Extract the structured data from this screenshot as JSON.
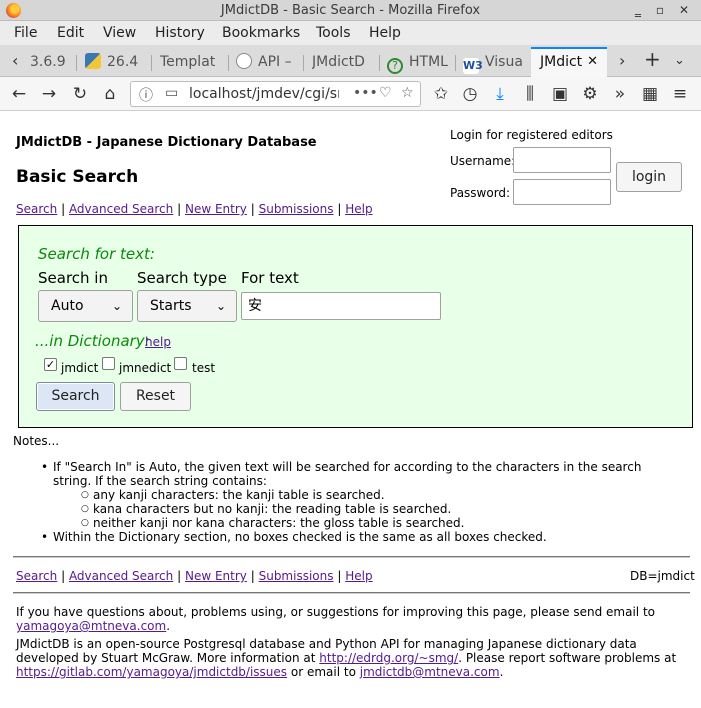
{
  "window": {
    "title": "JMdictDB - Basic Search - Mozilla Firefox"
  },
  "menu": [
    "File",
    "Edit",
    "View",
    "History",
    "Bookmarks",
    "Tools",
    "Help"
  ],
  "tabs": [
    {
      "label": "3.6.9"
    },
    {
      "label": "26.4"
    },
    {
      "label": "Templat"
    },
    {
      "label": "API –"
    },
    {
      "label": "JMdictD"
    },
    {
      "label": "HTML"
    },
    {
      "label": "Visua"
    },
    {
      "label": "JMdict"
    }
  ],
  "address": {
    "url": "localhost/jmdev/cgi/sr"
  },
  "site_title": "JMdictDB - Japanese Dictionary Database",
  "page_heading": "Basic Search",
  "nav": {
    "search": "Search",
    "advanced": "Advanced Search",
    "new_entry": "New Entry",
    "submissions": "Submissions",
    "help": "Help",
    "sep": "|"
  },
  "login": {
    "header": "Login for registered editors",
    "username_label": "Username:",
    "password_label": "Password:",
    "button": "login"
  },
  "search_form": {
    "heading": "Search for text:",
    "search_in_label": "Search in",
    "search_type_label": "Search type",
    "for_text_label": "For text",
    "search_in_value": "Auto",
    "search_type_value": "Starts",
    "text_value": "安",
    "dict_heading": "...in Dictionary:",
    "dict_help": "help",
    "dicts": [
      {
        "label": "jmdict",
        "checked": true
      },
      {
        "label": "jmnedict",
        "checked": false
      },
      {
        "label": "test",
        "checked": false
      }
    ],
    "search_button": "Search",
    "reset_button": "Reset"
  },
  "notes": {
    "title": "Notes...",
    "item1": "If \"Search In\" is Auto, the given text will be searched for according to the characters in the search string. If the search string contains:",
    "sub": [
      "any kanji characters: the kanji table is searched.",
      "kana characters but no kanji: the reading table is searched.",
      "neither kanji nor kana characters: the gloss table is searched."
    ],
    "item2": "Within the Dictionary section, no boxes checked is the same as all boxes checked."
  },
  "db_label": "DB=jmdict",
  "footer": {
    "p1": "If you have questions about, problems using, or suggestions for improving this page, please send email to",
    "email1": "yamagoya@mtneva.com",
    "p2a": "JMdictDB is an open-source Postgresql database and Python API for managing Japanese dictionary data developed by Stuart McGraw. More information at",
    "link1": "http://edrdg.org/~smg/",
    "p2b": ". Please report software problems at",
    "link2": "https://gitlab.com/yamagoya/jmdictdb/issues",
    "p2c": "or email to",
    "email2": "jmdictdb@mtneva.com"
  }
}
